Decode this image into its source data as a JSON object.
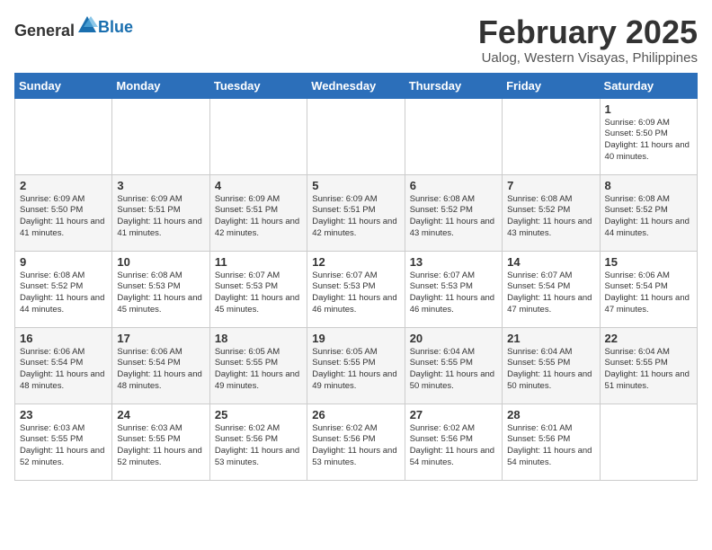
{
  "header": {
    "logo_general": "General",
    "logo_blue": "Blue",
    "month": "February 2025",
    "location": "Ualog, Western Visayas, Philippines"
  },
  "weekdays": [
    "Sunday",
    "Monday",
    "Tuesday",
    "Wednesday",
    "Thursday",
    "Friday",
    "Saturday"
  ],
  "weeks": [
    [
      {
        "day": "",
        "sunrise": "",
        "sunset": "",
        "daylight": ""
      },
      {
        "day": "",
        "sunrise": "",
        "sunset": "",
        "daylight": ""
      },
      {
        "day": "",
        "sunrise": "",
        "sunset": "",
        "daylight": ""
      },
      {
        "day": "",
        "sunrise": "",
        "sunset": "",
        "daylight": ""
      },
      {
        "day": "",
        "sunrise": "",
        "sunset": "",
        "daylight": ""
      },
      {
        "day": "",
        "sunrise": "",
        "sunset": "",
        "daylight": ""
      },
      {
        "day": "1",
        "sunrise": "Sunrise: 6:09 AM",
        "sunset": "Sunset: 5:50 PM",
        "daylight": "Daylight: 11 hours and 40 minutes."
      }
    ],
    [
      {
        "day": "2",
        "sunrise": "Sunrise: 6:09 AM",
        "sunset": "Sunset: 5:50 PM",
        "daylight": "Daylight: 11 hours and 41 minutes."
      },
      {
        "day": "3",
        "sunrise": "Sunrise: 6:09 AM",
        "sunset": "Sunset: 5:51 PM",
        "daylight": "Daylight: 11 hours and 41 minutes."
      },
      {
        "day": "4",
        "sunrise": "Sunrise: 6:09 AM",
        "sunset": "Sunset: 5:51 PM",
        "daylight": "Daylight: 11 hours and 42 minutes."
      },
      {
        "day": "5",
        "sunrise": "Sunrise: 6:09 AM",
        "sunset": "Sunset: 5:51 PM",
        "daylight": "Daylight: 11 hours and 42 minutes."
      },
      {
        "day": "6",
        "sunrise": "Sunrise: 6:08 AM",
        "sunset": "Sunset: 5:52 PM",
        "daylight": "Daylight: 11 hours and 43 minutes."
      },
      {
        "day": "7",
        "sunrise": "Sunrise: 6:08 AM",
        "sunset": "Sunset: 5:52 PM",
        "daylight": "Daylight: 11 hours and 43 minutes."
      },
      {
        "day": "8",
        "sunrise": "Sunrise: 6:08 AM",
        "sunset": "Sunset: 5:52 PM",
        "daylight": "Daylight: 11 hours and 44 minutes."
      }
    ],
    [
      {
        "day": "9",
        "sunrise": "Sunrise: 6:08 AM",
        "sunset": "Sunset: 5:52 PM",
        "daylight": "Daylight: 11 hours and 44 minutes."
      },
      {
        "day": "10",
        "sunrise": "Sunrise: 6:08 AM",
        "sunset": "Sunset: 5:53 PM",
        "daylight": "Daylight: 11 hours and 45 minutes."
      },
      {
        "day": "11",
        "sunrise": "Sunrise: 6:07 AM",
        "sunset": "Sunset: 5:53 PM",
        "daylight": "Daylight: 11 hours and 45 minutes."
      },
      {
        "day": "12",
        "sunrise": "Sunrise: 6:07 AM",
        "sunset": "Sunset: 5:53 PM",
        "daylight": "Daylight: 11 hours and 46 minutes."
      },
      {
        "day": "13",
        "sunrise": "Sunrise: 6:07 AM",
        "sunset": "Sunset: 5:53 PM",
        "daylight": "Daylight: 11 hours and 46 minutes."
      },
      {
        "day": "14",
        "sunrise": "Sunrise: 6:07 AM",
        "sunset": "Sunset: 5:54 PM",
        "daylight": "Daylight: 11 hours and 47 minutes."
      },
      {
        "day": "15",
        "sunrise": "Sunrise: 6:06 AM",
        "sunset": "Sunset: 5:54 PM",
        "daylight": "Daylight: 11 hours and 47 minutes."
      }
    ],
    [
      {
        "day": "16",
        "sunrise": "Sunrise: 6:06 AM",
        "sunset": "Sunset: 5:54 PM",
        "daylight": "Daylight: 11 hours and 48 minutes."
      },
      {
        "day": "17",
        "sunrise": "Sunrise: 6:06 AM",
        "sunset": "Sunset: 5:54 PM",
        "daylight": "Daylight: 11 hours and 48 minutes."
      },
      {
        "day": "18",
        "sunrise": "Sunrise: 6:05 AM",
        "sunset": "Sunset: 5:55 PM",
        "daylight": "Daylight: 11 hours and 49 minutes."
      },
      {
        "day": "19",
        "sunrise": "Sunrise: 6:05 AM",
        "sunset": "Sunset: 5:55 PM",
        "daylight": "Daylight: 11 hours and 49 minutes."
      },
      {
        "day": "20",
        "sunrise": "Sunrise: 6:04 AM",
        "sunset": "Sunset: 5:55 PM",
        "daylight": "Daylight: 11 hours and 50 minutes."
      },
      {
        "day": "21",
        "sunrise": "Sunrise: 6:04 AM",
        "sunset": "Sunset: 5:55 PM",
        "daylight": "Daylight: 11 hours and 50 minutes."
      },
      {
        "day": "22",
        "sunrise": "Sunrise: 6:04 AM",
        "sunset": "Sunset: 5:55 PM",
        "daylight": "Daylight: 11 hours and 51 minutes."
      }
    ],
    [
      {
        "day": "23",
        "sunrise": "Sunrise: 6:03 AM",
        "sunset": "Sunset: 5:55 PM",
        "daylight": "Daylight: 11 hours and 52 minutes."
      },
      {
        "day": "24",
        "sunrise": "Sunrise: 6:03 AM",
        "sunset": "Sunset: 5:55 PM",
        "daylight": "Daylight: 11 hours and 52 minutes."
      },
      {
        "day": "25",
        "sunrise": "Sunrise: 6:02 AM",
        "sunset": "Sunset: 5:56 PM",
        "daylight": "Daylight: 11 hours and 53 minutes."
      },
      {
        "day": "26",
        "sunrise": "Sunrise: 6:02 AM",
        "sunset": "Sunset: 5:56 PM",
        "daylight": "Daylight: 11 hours and 53 minutes."
      },
      {
        "day": "27",
        "sunrise": "Sunrise: 6:02 AM",
        "sunset": "Sunset: 5:56 PM",
        "daylight": "Daylight: 11 hours and 54 minutes."
      },
      {
        "day": "28",
        "sunrise": "Sunrise: 6:01 AM",
        "sunset": "Sunset: 5:56 PM",
        "daylight": "Daylight: 11 hours and 54 minutes."
      },
      {
        "day": "",
        "sunrise": "",
        "sunset": "",
        "daylight": ""
      }
    ]
  ]
}
